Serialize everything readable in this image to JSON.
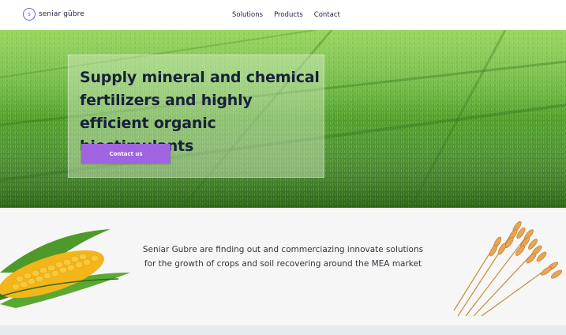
{
  "header": {
    "logo_mark": "s",
    "logo_text": "seniar gübre",
    "nav": [
      {
        "label": "Solutions"
      },
      {
        "label": "Products"
      },
      {
        "label": "Contact"
      }
    ]
  },
  "hero": {
    "title": "Supply mineral and chemical fertilizers and highly efficient organic biostimulants",
    "button_label": "Contact us"
  },
  "intro": {
    "text": "Seniar Gubre are finding out and commerciazing innovate solutions for the growth of crops and soil recovering around the MEA market"
  },
  "colors": {
    "accent": "#a064e0",
    "logo": "#6a5fd6",
    "heading": "#17213a",
    "section_bg": "#f6f6f6"
  },
  "icons": {
    "logo": "brand-logo-icon",
    "corn": "corn-cob-image",
    "wheat": "wheat-bundle-image"
  }
}
